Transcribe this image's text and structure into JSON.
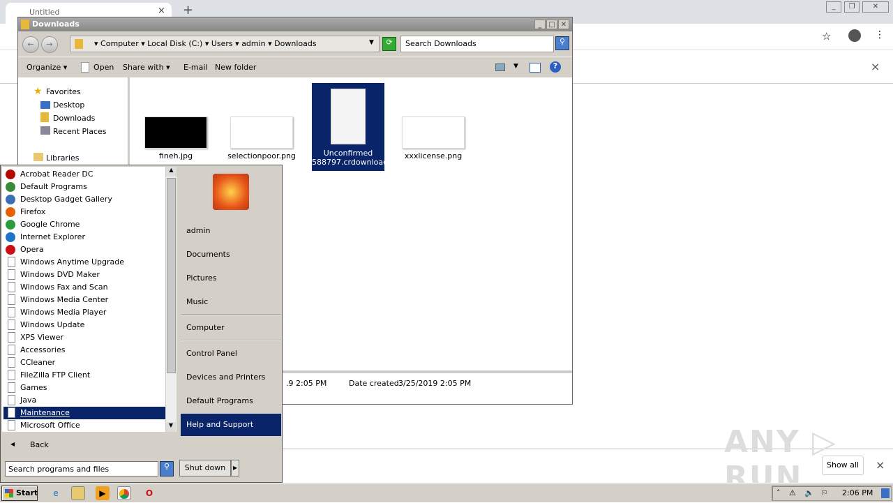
{
  "browser": {
    "tab_title": "Untitled",
    "tab_close": "×",
    "new_tab": "+",
    "infobar_close": "×"
  },
  "explorer": {
    "title": "Downloads",
    "breadcrumb": [
      "Computer",
      "Local Disk (C:)",
      "Users",
      "admin",
      "Downloads"
    ],
    "search_placeholder": "Search Downloads",
    "toolbar": {
      "organize": "Organize",
      "open": "Open",
      "share_with": "Share with",
      "email": "E-mail",
      "new_folder": "New folder"
    },
    "nav": {
      "favorites": "Favorites",
      "desktop": "Desktop",
      "downloads": "Downloads",
      "recent_places": "Recent Places",
      "libraries": "Libraries"
    },
    "files": [
      {
        "name": "fineh.jpg",
        "thumb": "#000000"
      },
      {
        "name": "selectionpoor.png",
        "thumb": "#ffffff"
      },
      {
        "name": "Unconfirmed 588797.crdownload",
        "selected": true
      },
      {
        "name": "xxxlicense.png",
        "thumb": "#ffffff"
      }
    ],
    "details": {
      "modified_partial": ".9 2:05 PM",
      "date_created_label": "Date created:",
      "date_created": "3/25/2019 2:05 PM"
    }
  },
  "start_menu": {
    "programs": [
      {
        "label": "Acrobat Reader DC",
        "icon": "acrobat-icon",
        "color": "#b30b00"
      },
      {
        "label": "Default Programs",
        "icon": "default-programs-icon",
        "color": "#3a8a3a"
      },
      {
        "label": "Desktop Gadget Gallery",
        "icon": "gadget-icon",
        "color": "#3b6fb6"
      },
      {
        "label": "Firefox",
        "icon": "firefox-icon",
        "color": "#e66000"
      },
      {
        "label": "Google Chrome",
        "icon": "chrome-icon",
        "color": "#2a9d3f"
      },
      {
        "label": "Internet Explorer",
        "icon": "ie-icon",
        "color": "#1e73c8"
      },
      {
        "label": "Opera",
        "icon": "opera-icon",
        "color": "#cc0f16"
      },
      {
        "label": "Windows Anytime Upgrade"
      },
      {
        "label": "Windows DVD Maker"
      },
      {
        "label": "Windows Fax and Scan"
      },
      {
        "label": "Windows Media Center"
      },
      {
        "label": "Windows Media Player"
      },
      {
        "label": "Windows Update"
      },
      {
        "label": "XPS Viewer"
      },
      {
        "label": "Accessories"
      },
      {
        "label": "CCleaner"
      },
      {
        "label": "FileZilla FTP Client"
      },
      {
        "label": "Games"
      },
      {
        "label": "Java"
      },
      {
        "label": "Maintenance",
        "selected": true
      },
      {
        "label": "Microsoft Office"
      }
    ],
    "back": "Back",
    "search_placeholder": "Search programs and files",
    "right": [
      "admin",
      "Documents",
      "Pictures",
      "Music",
      "Computer",
      "Control Panel",
      "Devices and Printers",
      "Default Programs",
      "Help and Support"
    ],
    "shutdown": "Shut down"
  },
  "downloads_bar": {
    "show_all": "Show all",
    "close": "×"
  },
  "watermark": "ANY RUN",
  "taskbar": {
    "start": "Start",
    "clock": "2:06 PM"
  }
}
